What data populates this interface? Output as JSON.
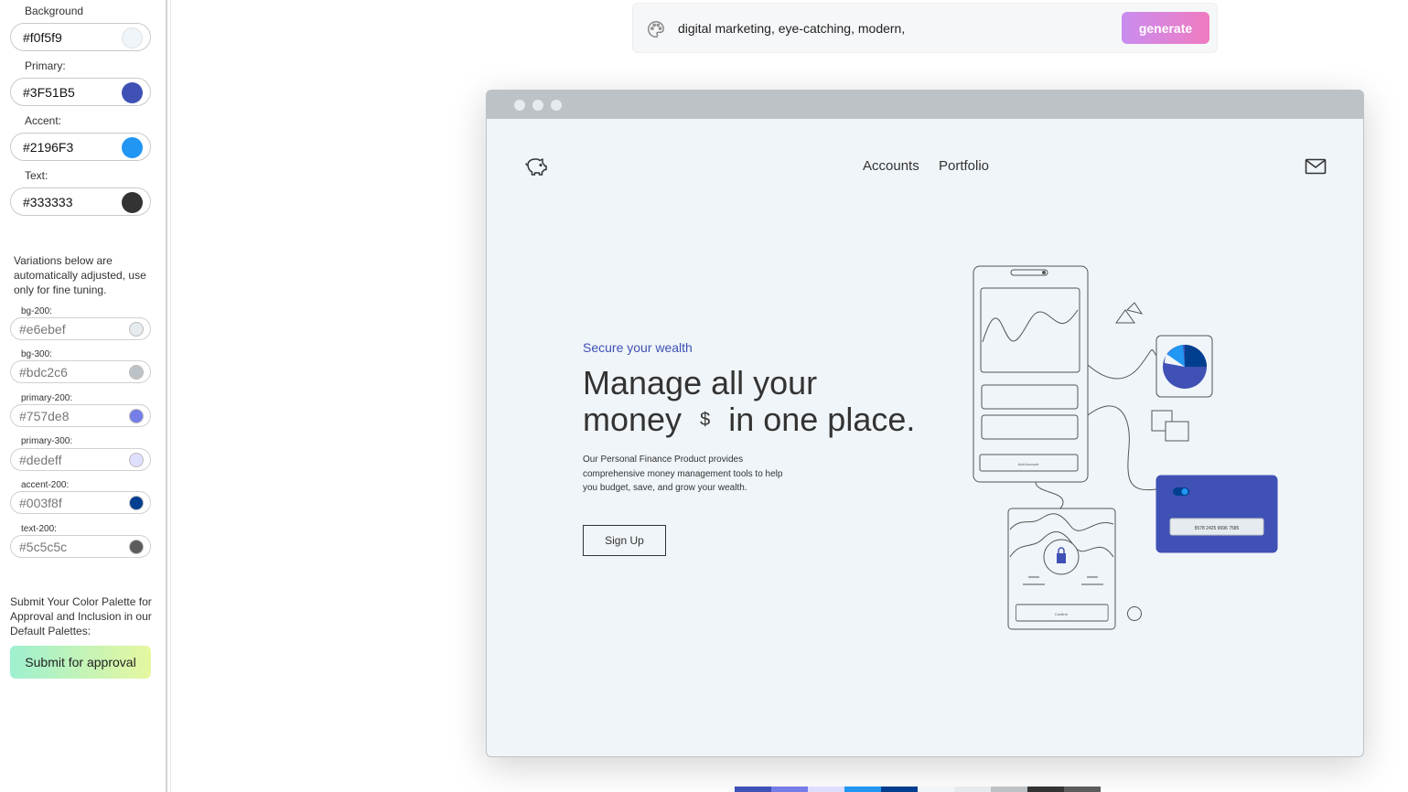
{
  "sidebar": {
    "main_colors": [
      {
        "label": "Background",
        "value": "#f0f5f9",
        "swatch": "#f0f5f9"
      },
      {
        "label": "Primary:",
        "value": "#3F51B5",
        "swatch": "#3F51B5"
      },
      {
        "label": "Accent:",
        "value": "#2196F3",
        "swatch": "#2196F3"
      },
      {
        "label": "Text:",
        "value": "#333333",
        "swatch": "#333333"
      }
    ],
    "note": "Variations below are automatically adjusted, use only for fine tuning.",
    "variations": [
      {
        "label": "bg-200:",
        "value": "#e6ebef",
        "swatch": "#e6ebef"
      },
      {
        "label": "bg-300:",
        "value": "#bdc2c6",
        "swatch": "#bdc2c6"
      },
      {
        "label": "primary-200:",
        "value": "#757de8",
        "swatch": "#757de8"
      },
      {
        "label": "primary-300:",
        "value": "#dedeff",
        "swatch": "#dedeff"
      },
      {
        "label": "accent-200:",
        "value": "#003f8f",
        "swatch": "#003f8f"
      },
      {
        "label": "text-200:",
        "value": "#5c5c5c",
        "swatch": "#5c5c5c"
      }
    ],
    "submit_note": "Submit Your Color Palette for Approval and Inclusion in our Default Palettes:",
    "submit_label": "Submit for approval"
  },
  "prompt": {
    "text": "digital marketing, eye-catching, modern,",
    "generate_label": "generate",
    "icon": "palette-icon"
  },
  "preview": {
    "nav": {
      "accounts": "Accounts",
      "portfolio": "Portfolio"
    },
    "eyebrow": "Secure your wealth",
    "headline_line1": "Manage all your",
    "headline_money": "money",
    "headline_symbol": "$",
    "headline_rest": "in one place.",
    "description": "Our Personal Finance Product provides comprehensive money management tools to help you budget, save, and grow your wealth.",
    "signup_label": "Sign Up",
    "illustration": {
      "phone_button": "Add Account",
      "card_number": "5578 2425 9696 7585",
      "confirm_label": "Confirm"
    }
  },
  "palette_strip": [
    "#3F51B5",
    "#757de8",
    "#dedeff",
    "#2196F3",
    "#003f8f",
    "#f0f5f9",
    "#e6ebef",
    "#bdc2c6",
    "#333333",
    "#5c5c5c"
  ]
}
